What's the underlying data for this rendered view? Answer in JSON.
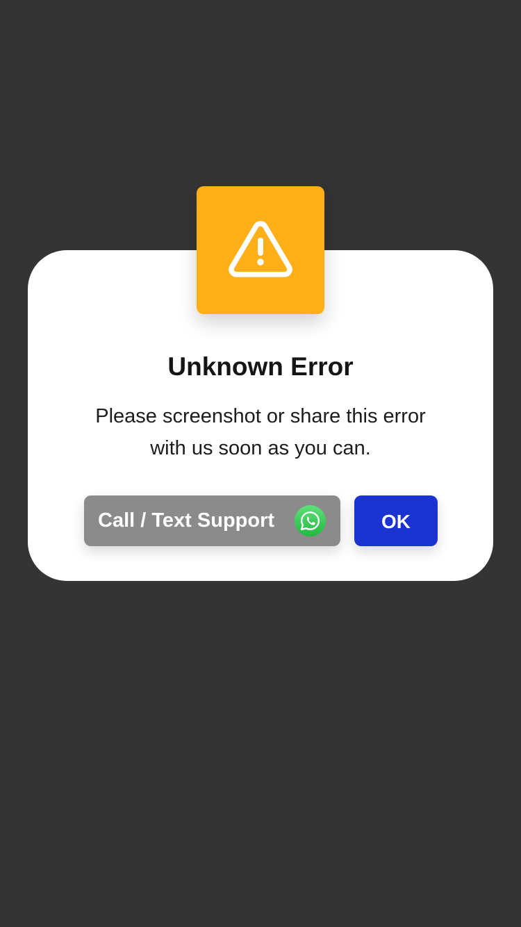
{
  "dialog": {
    "title": "Unknown Error",
    "message": "Please screenshot or share this error with us soon as you can.",
    "support_button_label": "Call / Text Support",
    "ok_button_label": "OK"
  },
  "icons": {
    "badge": "warning-triangle-icon",
    "support": "whatsapp-icon"
  },
  "colors": {
    "backdrop": "#343434",
    "warning": "#ffb018",
    "support_button": "#8b8b8b",
    "ok_button": "#1a33d1",
    "whatsapp": "#25d366"
  }
}
